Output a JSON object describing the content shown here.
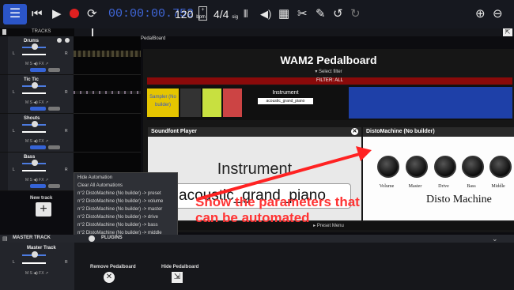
{
  "toolbar": {
    "time": "00:00:00.752",
    "tempo": "120",
    "tempo_unit": "bpm",
    "signature": "4/4",
    "signature_unit": "sig"
  },
  "tracks_header": "TRACKS",
  "tracks": [
    {
      "name": "Drums"
    },
    {
      "name": "Tic Tic"
    },
    {
      "name": "Shouts"
    },
    {
      "name": "Bass"
    }
  ],
  "track_labels": {
    "left": "L",
    "right": "R",
    "msfx": "M  S  ◀)  FX  ↗"
  },
  "new_track": "New track",
  "pedalboard": {
    "label": "PedalBoard",
    "title": "WAM2 Pedalboard",
    "select_filter": "▾ Select filter",
    "filter": "FILTER: ALL",
    "instrument_label": "Instrument",
    "instrument_value": "acoustic_grand_piano",
    "sampler_label": "Sampler (No builder)",
    "preset_menu": "▸ Preset Menu"
  },
  "soundfont": {
    "header": "Soundfont Player",
    "instrument": "Instrument",
    "select": "acoustic_grand_piano"
  },
  "disto": {
    "header": "DistoMachine (No builder)",
    "knobs": [
      "Volume",
      "Master",
      "Drive",
      "Bass",
      "Middle"
    ],
    "name": "Disto Machine"
  },
  "context_menu": [
    "Hide Automation",
    "Clear All Automations",
    "n°2 DistoMachine (No builder) -> preset",
    "n°2 DistoMachine (No builder) -> volume",
    "n°2 DistoMachine (No builder) -> master",
    "n°2 DistoMachine (No builder) -> drive",
    "n°2 DistoMachine (No builder) -> bass",
    "n°2 DistoMachine (No builder) -> middle"
  ],
  "bottom": {
    "master_track": "MASTER TRACK",
    "plugins": "PLUGINS",
    "master_name": "Master Track",
    "remove_pedalboard": "Remove Pedalboard",
    "hide_pedalboard": "Hide Pedalboard"
  },
  "annotation": {
    "line1": "Show the parameters that",
    "line2": "can be automated",
    "color": "#ff2222"
  },
  "colors": {
    "accent": "#2b55c8",
    "record": "#e02020",
    "filter_bar": "#8a0a0a"
  }
}
